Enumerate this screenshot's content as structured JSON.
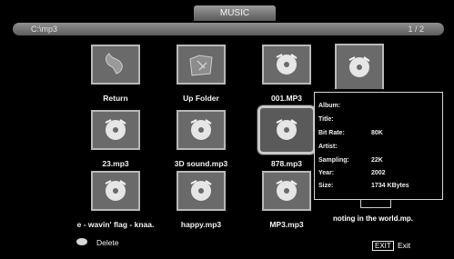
{
  "header": {
    "title": "MUSIC"
  },
  "path_bar": {
    "path": "C:\\mp3",
    "page": "1 / 2"
  },
  "grid": [
    {
      "label": "Return",
      "icon": "return-icon"
    },
    {
      "label": "Up Folder",
      "icon": "folder-icon"
    },
    {
      "label": "001.MP3",
      "icon": "music-file-icon"
    },
    {
      "label": "23.mp3",
      "icon": "music-file-icon"
    },
    {
      "label": "3D sound.mp3",
      "icon": "music-file-icon"
    },
    {
      "label": "878.mp3",
      "icon": "music-file-icon",
      "selected": true
    },
    {
      "label": "e - wavin' flag - knaa.",
      "icon": "music-file-icon"
    },
    {
      "label": "happy.mp3",
      "icon": "music-file-icon"
    },
    {
      "label": "MP3.mp3",
      "icon": "music-file-icon"
    }
  ],
  "partial_items": {
    "bottom_label": "noting in the world.mp."
  },
  "info_panel": {
    "album": {
      "key": "Album:",
      "value": ""
    },
    "title": {
      "key": "Title:",
      "value": ""
    },
    "bitrate": {
      "key": "Bit Rate:",
      "value": "80K"
    },
    "artist": {
      "key": "Artist:",
      "value": ""
    },
    "sampling": {
      "key": "Sampling:",
      "value": "22K"
    },
    "year": {
      "key": "Year:",
      "value": "2002"
    },
    "size": {
      "key": "Size:",
      "value": "1734 KBytes"
    }
  },
  "footer": {
    "delete_label": "Delete",
    "exit_key": "EXIT",
    "exit_label": "Exit"
  },
  "colors": {
    "background": "#000000",
    "bar": "#6e6e6e",
    "thumb": "#6a6a6a"
  }
}
